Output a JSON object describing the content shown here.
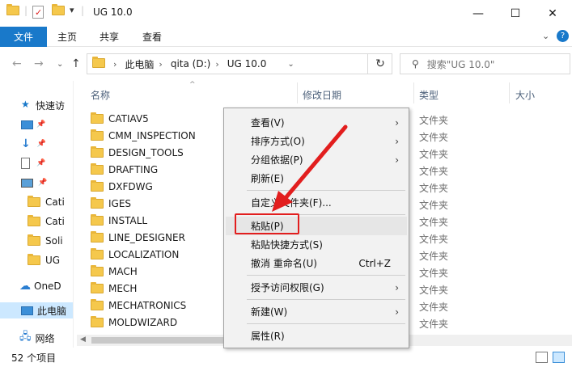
{
  "window": {
    "title": "UG 10.0",
    "controls": [
      "—",
      "☐",
      "✕"
    ]
  },
  "ribbon": {
    "file_tab": "文件",
    "tabs": [
      "主页",
      "共享",
      "查看"
    ]
  },
  "address": {
    "crumbs": [
      "此电脑",
      "qita (D:)",
      "UG 10.0"
    ],
    "search_placeholder": "搜索\"UG 10.0\""
  },
  "nav": {
    "items": [
      "快速访",
      "",
      "",
      "",
      "",
      "Cati",
      "Cati",
      "Soli",
      "UG",
      "OneD",
      "此电脑",
      "网络"
    ]
  },
  "columns": {
    "name": "名称",
    "modified": "修改日期",
    "type": "类型",
    "size": "大小"
  },
  "files": [
    {
      "name": "CATIAV5",
      "type": "文件夹"
    },
    {
      "name": "CMM_INSPECTION",
      "type": "文件夹"
    },
    {
      "name": "DESIGN_TOOLS",
      "type": "文件夹"
    },
    {
      "name": "DRAFTING",
      "type": "文件夹"
    },
    {
      "name": "DXFDWG",
      "type": "文件夹"
    },
    {
      "name": "IGES",
      "type": "文件夹"
    },
    {
      "name": "INSTALL",
      "type": "文件夹"
    },
    {
      "name": "LINE_DESIGNER",
      "type": "文件夹"
    },
    {
      "name": "LOCALIZATION",
      "type": "文件夹"
    },
    {
      "name": "MACH",
      "type": "文件夹"
    },
    {
      "name": "MECH",
      "type": "文件夹"
    },
    {
      "name": "MECHATRONICS",
      "type": "文件夹"
    },
    {
      "name": "MOLDWIZARD",
      "type": "文件夹"
    }
  ],
  "status": {
    "count": "52 个项目"
  },
  "context_menu": {
    "view": "查看(V)",
    "sort": "排序方式(O)",
    "group": "分组依据(P)",
    "refresh": "刷新(E)",
    "customize": "自定义文件夹(F)...",
    "paste": "粘贴(P)",
    "paste_shortcut": "粘贴快捷方式(S)",
    "undo": "撤消 重命名(U)",
    "undo_key": "Ctrl+Z",
    "access": "授予访问权限(G)",
    "new": "新建(W)",
    "properties": "属性(R)"
  },
  "colors": {
    "accent": "#1979ca",
    "highlight": "#e21e1e"
  }
}
